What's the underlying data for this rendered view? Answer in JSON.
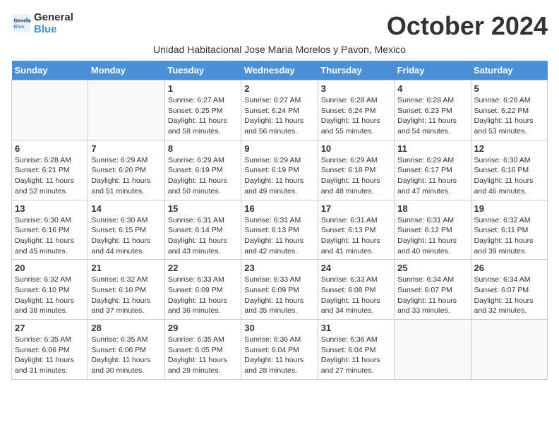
{
  "logo": {
    "line1": "General",
    "line2": "Blue"
  },
  "title": "October 2024",
  "subtitle": "Unidad Habitacional Jose Maria Morelos y Pavon, Mexico",
  "days_of_week": [
    "Sunday",
    "Monday",
    "Tuesday",
    "Wednesday",
    "Thursday",
    "Friday",
    "Saturday"
  ],
  "weeks": [
    [
      {
        "day": "",
        "sunrise": "",
        "sunset": "",
        "daylight": ""
      },
      {
        "day": "",
        "sunrise": "",
        "sunset": "",
        "daylight": ""
      },
      {
        "day": "1",
        "sunrise": "Sunrise: 6:27 AM",
        "sunset": "Sunset: 6:25 PM",
        "daylight": "Daylight: 11 hours and 58 minutes."
      },
      {
        "day": "2",
        "sunrise": "Sunrise: 6:27 AM",
        "sunset": "Sunset: 6:24 PM",
        "daylight": "Daylight: 11 hours and 56 minutes."
      },
      {
        "day": "3",
        "sunrise": "Sunrise: 6:28 AM",
        "sunset": "Sunset: 6:24 PM",
        "daylight": "Daylight: 11 hours and 55 minutes."
      },
      {
        "day": "4",
        "sunrise": "Sunrise: 6:28 AM",
        "sunset": "Sunset: 6:23 PM",
        "daylight": "Daylight: 11 hours and 54 minutes."
      },
      {
        "day": "5",
        "sunrise": "Sunrise: 6:28 AM",
        "sunset": "Sunset: 6:22 PM",
        "daylight": "Daylight: 11 hours and 53 minutes."
      }
    ],
    [
      {
        "day": "6",
        "sunrise": "Sunrise: 6:28 AM",
        "sunset": "Sunset: 6:21 PM",
        "daylight": "Daylight: 11 hours and 52 minutes."
      },
      {
        "day": "7",
        "sunrise": "Sunrise: 6:29 AM",
        "sunset": "Sunset: 6:20 PM",
        "daylight": "Daylight: 11 hours and 51 minutes."
      },
      {
        "day": "8",
        "sunrise": "Sunrise: 6:29 AM",
        "sunset": "Sunset: 6:19 PM",
        "daylight": "Daylight: 11 hours and 50 minutes."
      },
      {
        "day": "9",
        "sunrise": "Sunrise: 6:29 AM",
        "sunset": "Sunset: 6:19 PM",
        "daylight": "Daylight: 11 hours and 49 minutes."
      },
      {
        "day": "10",
        "sunrise": "Sunrise: 6:29 AM",
        "sunset": "Sunset: 6:18 PM",
        "daylight": "Daylight: 11 hours and 48 minutes."
      },
      {
        "day": "11",
        "sunrise": "Sunrise: 6:29 AM",
        "sunset": "Sunset: 6:17 PM",
        "daylight": "Daylight: 11 hours and 47 minutes."
      },
      {
        "day": "12",
        "sunrise": "Sunrise: 6:30 AM",
        "sunset": "Sunset: 6:16 PM",
        "daylight": "Daylight: 11 hours and 46 minutes."
      }
    ],
    [
      {
        "day": "13",
        "sunrise": "Sunrise: 6:30 AM",
        "sunset": "Sunset: 6:16 PM",
        "daylight": "Daylight: 11 hours and 45 minutes."
      },
      {
        "day": "14",
        "sunrise": "Sunrise: 6:30 AM",
        "sunset": "Sunset: 6:15 PM",
        "daylight": "Daylight: 11 hours and 44 minutes."
      },
      {
        "day": "15",
        "sunrise": "Sunrise: 6:31 AM",
        "sunset": "Sunset: 6:14 PM",
        "daylight": "Daylight: 11 hours and 43 minutes."
      },
      {
        "day": "16",
        "sunrise": "Sunrise: 6:31 AM",
        "sunset": "Sunset: 6:13 PM",
        "daylight": "Daylight: 11 hours and 42 minutes."
      },
      {
        "day": "17",
        "sunrise": "Sunrise: 6:31 AM",
        "sunset": "Sunset: 6:13 PM",
        "daylight": "Daylight: 11 hours and 41 minutes."
      },
      {
        "day": "18",
        "sunrise": "Sunrise: 6:31 AM",
        "sunset": "Sunset: 6:12 PM",
        "daylight": "Daylight: 11 hours and 40 minutes."
      },
      {
        "day": "19",
        "sunrise": "Sunrise: 6:32 AM",
        "sunset": "Sunset: 6:11 PM",
        "daylight": "Daylight: 11 hours and 39 minutes."
      }
    ],
    [
      {
        "day": "20",
        "sunrise": "Sunrise: 6:32 AM",
        "sunset": "Sunset: 6:10 PM",
        "daylight": "Daylight: 11 hours and 38 minutes."
      },
      {
        "day": "21",
        "sunrise": "Sunrise: 6:32 AM",
        "sunset": "Sunset: 6:10 PM",
        "daylight": "Daylight: 11 hours and 37 minutes."
      },
      {
        "day": "22",
        "sunrise": "Sunrise: 6:33 AM",
        "sunset": "Sunset: 6:09 PM",
        "daylight": "Daylight: 11 hours and 36 minutes."
      },
      {
        "day": "23",
        "sunrise": "Sunrise: 6:33 AM",
        "sunset": "Sunset: 6:09 PM",
        "daylight": "Daylight: 11 hours and 35 minutes."
      },
      {
        "day": "24",
        "sunrise": "Sunrise: 6:33 AM",
        "sunset": "Sunset: 6:08 PM",
        "daylight": "Daylight: 11 hours and 34 minutes."
      },
      {
        "day": "25",
        "sunrise": "Sunrise: 6:34 AM",
        "sunset": "Sunset: 6:07 PM",
        "daylight": "Daylight: 11 hours and 33 minutes."
      },
      {
        "day": "26",
        "sunrise": "Sunrise: 6:34 AM",
        "sunset": "Sunset: 6:07 PM",
        "daylight": "Daylight: 11 hours and 32 minutes."
      }
    ],
    [
      {
        "day": "27",
        "sunrise": "Sunrise: 6:35 AM",
        "sunset": "Sunset: 6:06 PM",
        "daylight": "Daylight: 11 hours and 31 minutes."
      },
      {
        "day": "28",
        "sunrise": "Sunrise: 6:35 AM",
        "sunset": "Sunset: 6:06 PM",
        "daylight": "Daylight: 11 hours and 30 minutes."
      },
      {
        "day": "29",
        "sunrise": "Sunrise: 6:35 AM",
        "sunset": "Sunset: 6:05 PM",
        "daylight": "Daylight: 11 hours and 29 minutes."
      },
      {
        "day": "30",
        "sunrise": "Sunrise: 6:36 AM",
        "sunset": "Sunset: 6:04 PM",
        "daylight": "Daylight: 11 hours and 28 minutes."
      },
      {
        "day": "31",
        "sunrise": "Sunrise: 6:36 AM",
        "sunset": "Sunset: 6:04 PM",
        "daylight": "Daylight: 11 hours and 27 minutes."
      },
      {
        "day": "",
        "sunrise": "",
        "sunset": "",
        "daylight": ""
      },
      {
        "day": "",
        "sunrise": "",
        "sunset": "",
        "daylight": ""
      }
    ]
  ]
}
